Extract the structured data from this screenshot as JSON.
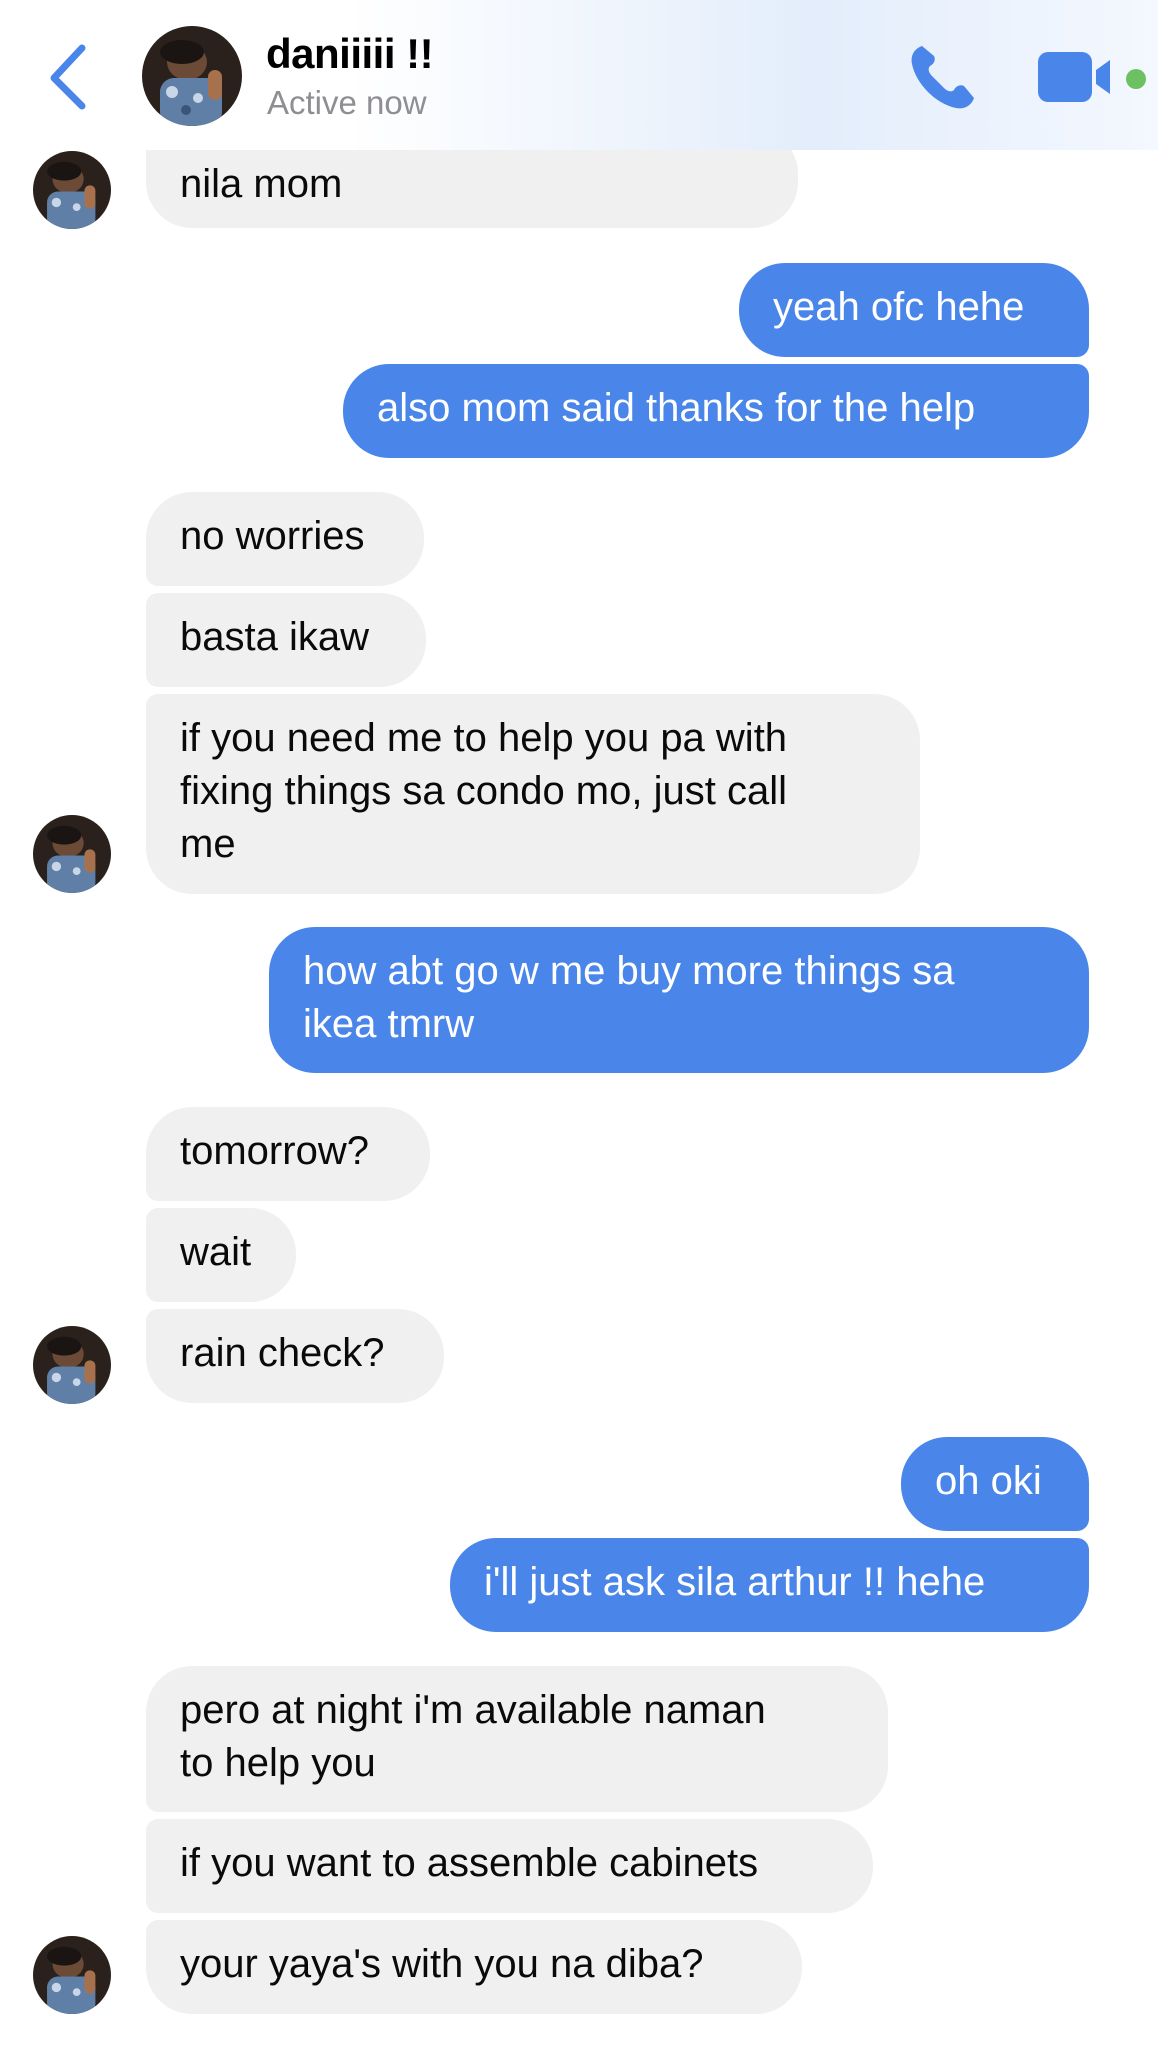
{
  "header": {
    "contact_name": "daniiiii !!",
    "status": "Active now",
    "back_icon": "chevron-left-icon",
    "call_icon": "phone-icon",
    "video_icon": "video-camera-icon",
    "accent_color": "#4a86ea",
    "online_color": "#6ec163"
  },
  "messages": [
    {
      "dir": "in",
      "lines": [
        "nila mom"
      ]
    },
    {
      "dir": "out",
      "lines": [
        "yeah ofc hehe"
      ]
    },
    {
      "dir": "out",
      "lines": [
        "also mom said thanks for the help"
      ]
    },
    {
      "dir": "in",
      "lines": [
        "no worries"
      ]
    },
    {
      "dir": "in",
      "lines": [
        "basta ikaw"
      ]
    },
    {
      "dir": "in",
      "lines": [
        "if you need me to help you pa with",
        "fixing things sa condo mo, just call",
        "me"
      ]
    },
    {
      "dir": "out",
      "lines": [
        "how abt go w me buy more things sa",
        "ikea tmrw"
      ]
    },
    {
      "dir": "in",
      "lines": [
        "tomorrow?"
      ]
    },
    {
      "dir": "in",
      "lines": [
        "wait"
      ]
    },
    {
      "dir": "in",
      "lines": [
        "rain check?"
      ]
    },
    {
      "dir": "out",
      "lines": [
        "oh oki"
      ]
    },
    {
      "dir": "out",
      "lines": [
        "i'll just ask sila arthur !! hehe"
      ]
    },
    {
      "dir": "in",
      "lines": [
        "pero at night i'm available naman",
        "to help you"
      ]
    },
    {
      "dir": "in",
      "lines": [
        "if you want to assemble cabinets"
      ]
    },
    {
      "dir": "in",
      "lines": [
        "your yaya's with you na diba?"
      ]
    }
  ]
}
